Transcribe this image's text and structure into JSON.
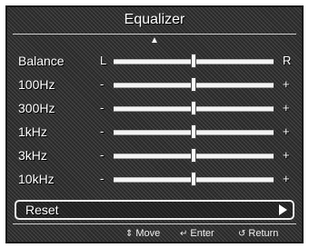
{
  "title": "Equalizer",
  "rows": [
    {
      "label": "Balance",
      "left_mark": "L",
      "right_mark": "R",
      "level": 0.5
    },
    {
      "label": "100Hz",
      "left_mark": "-",
      "right_mark": "+",
      "level": 0.5
    },
    {
      "label": "300Hz",
      "left_mark": "-",
      "right_mark": "+",
      "level": 0.5
    },
    {
      "label": "1kHz",
      "left_mark": "-",
      "right_mark": "+",
      "level": 0.5
    },
    {
      "label": "3kHz",
      "left_mark": "-",
      "right_mark": "+",
      "level": 0.5
    },
    {
      "label": "10kHz",
      "left_mark": "-",
      "right_mark": "+",
      "level": 0.5
    }
  ],
  "reset": {
    "label": "Reset",
    "icon": "play-icon"
  },
  "footer": {
    "move": {
      "icon": "up-down-arrow-icon",
      "label": "Move"
    },
    "enter": {
      "icon": "enter-icon",
      "label": "Enter"
    },
    "return": {
      "icon": "return-icon",
      "label": "Return"
    }
  }
}
